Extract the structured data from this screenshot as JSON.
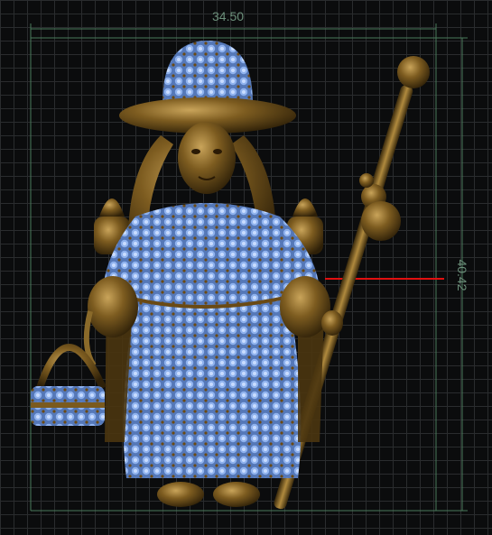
{
  "viewport": {
    "background": "#0b0c0d",
    "grid_color": "#2a2c2e"
  },
  "dimensions": {
    "width_value": "34.50",
    "height_value": "40.42",
    "line_color": "#4a7a5a",
    "marker_color": "#e01010"
  },
  "model": {
    "name": "shepherdess-figurine",
    "bronze_color": "#7a5a1e",
    "bronze_highlight": "#c0a050",
    "gem_color": "#7fa6e6",
    "gem_dark": "#4a6fb0"
  }
}
